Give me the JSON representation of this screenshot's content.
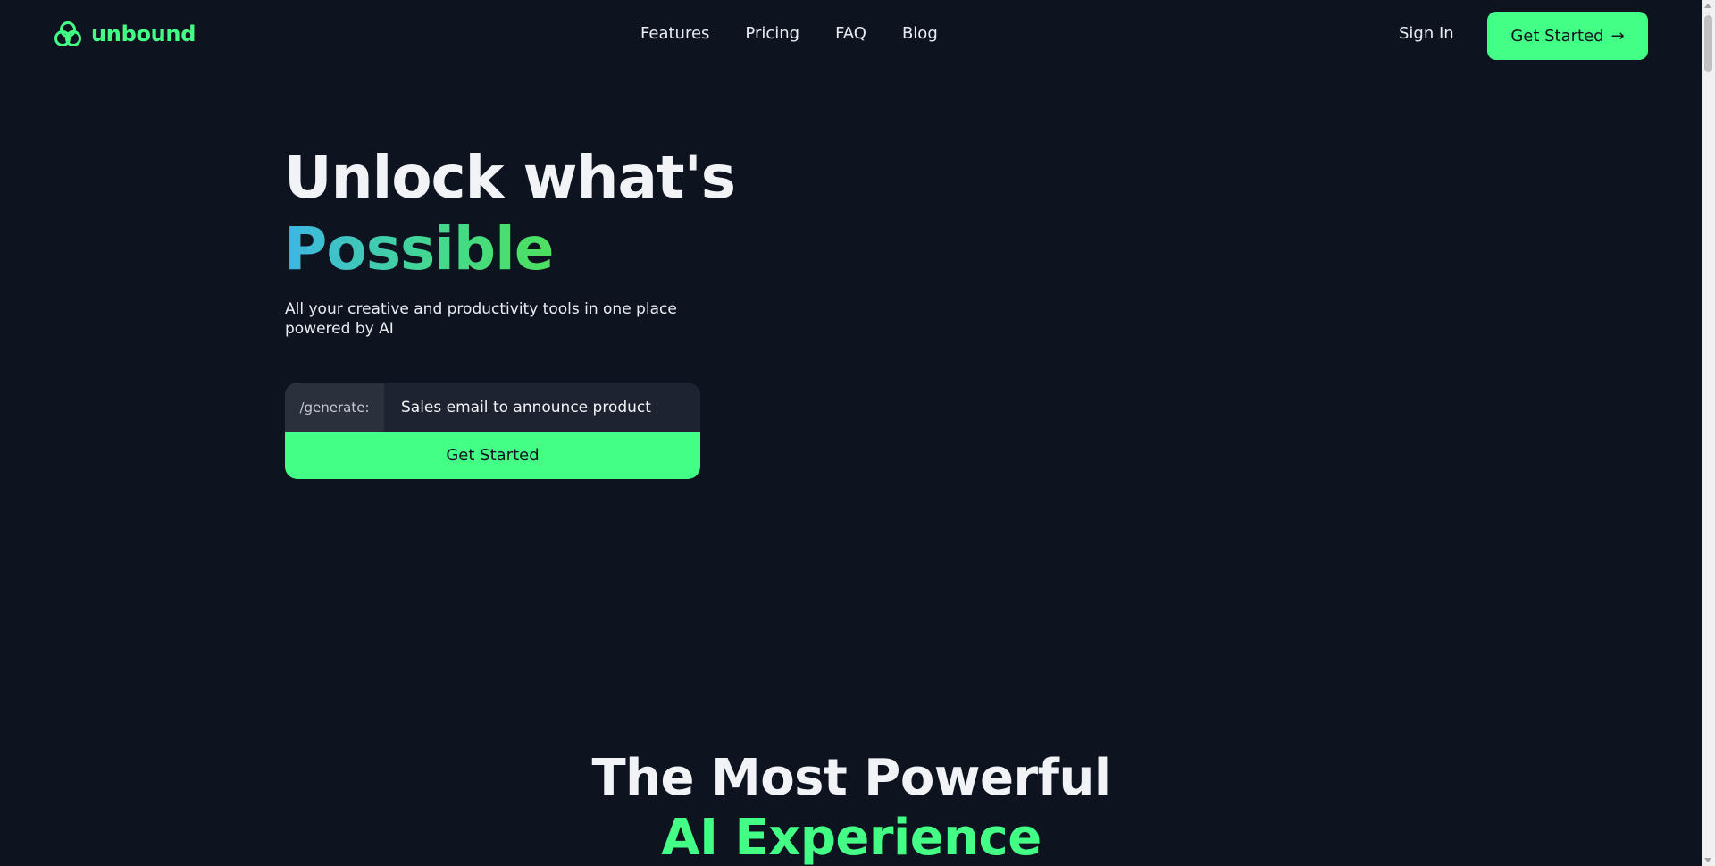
{
  "header": {
    "logo_text": "unbound",
    "nav": [
      "Features",
      "Pricing",
      "FAQ",
      "Blog"
    ],
    "sign_in": "Sign In",
    "cta": "Get Started",
    "cta_arrow": "→"
  },
  "hero": {
    "title_line1": "Unlock what's",
    "title_line2": "Possible",
    "subtitle": "All your creative and productivity tools in one place powered by AI",
    "prompt_prefix": "/generate:",
    "prompt_value": "Sales email to announce product",
    "cta": "Get Started"
  },
  "section": {
    "title_line1": "The Most Powerful",
    "title_line2": "AI Experience"
  },
  "colors": {
    "background": "#0e141f",
    "accent": "#43ff85",
    "gradient_start": "#3db6e6",
    "gradient_end": "#4ee05e"
  },
  "icons": {
    "logo": "unbound-logo-icon",
    "arrow": "arrow-right-icon"
  }
}
